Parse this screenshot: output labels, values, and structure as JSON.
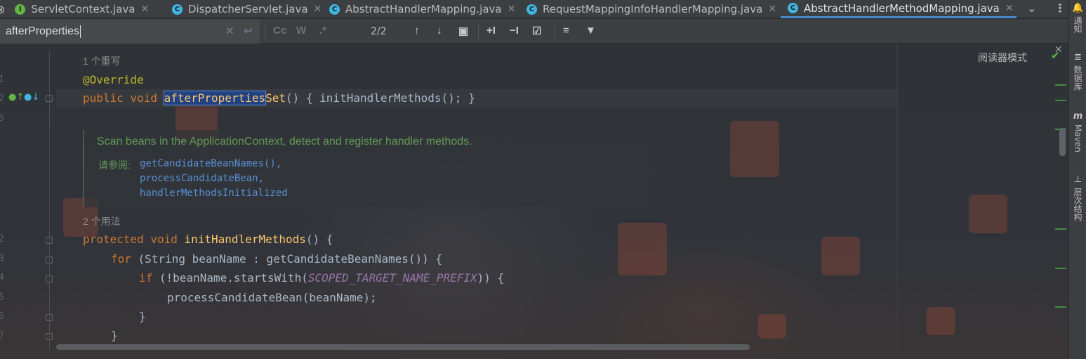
{
  "tabs": [
    {
      "label": "ServletContext.java",
      "icon": "interface-icon",
      "badge": "I",
      "active": false
    },
    {
      "label": "DispatcherServlet.java",
      "icon": "class-icon",
      "badge": "C",
      "active": false
    },
    {
      "label": "AbstractHandlerMapping.java",
      "icon": "class-icon",
      "badge": "C",
      "active": false
    },
    {
      "label": "RequestMappingInfoHandlerMapping.java",
      "icon": "class-icon",
      "badge": "C",
      "active": false
    },
    {
      "label": "AbstractHandlerMethodMapping.java",
      "icon": "class-icon",
      "badge": "C",
      "active": true
    }
  ],
  "search": {
    "value": "afterProperties",
    "match_count": "2/2",
    "case_btn": "Cc",
    "words_btn": "W",
    "regex_btn": ".*"
  },
  "editor": {
    "reader_mode": "阅读器模式",
    "hint_overrides": "1 个重写",
    "annotation": "@Override",
    "line_after_props": {
      "kw": "public void ",
      "match": "afterProperties",
      "rest_fn": "Set",
      "rest": "() { initHandlerMethods(); }"
    },
    "doc": {
      "text": "Scan beans in the ApplicationContext, detect and register handler methods.",
      "see_label": "请参阅:",
      "links": [
        "getCandidateBeanNames(),",
        "processCandidateBean,",
        "handlerMethodsInitialized"
      ]
    },
    "hint_usages": "2 个用法",
    "lines": {
      "l1_kw": "protected void ",
      "l1_fn": "initHandlerMethods",
      "l1_rest": "() {",
      "l2_kw": "for ",
      "l2_rest": "(String beanName : getCandidateBeanNames()) {",
      "l3_kw": "if ",
      "l3_a": "(!beanName.startsWith(",
      "l3_const": "SCOPED_TARGET_NAME_PREFIX",
      "l3_b": ")) {",
      "l4": "processCandidateBean(beanName);",
      "l5": "}",
      "l6": "}"
    },
    "line_numbers": [
      "1",
      "2",
      "5",
      "2",
      "3",
      "4",
      "5",
      "6",
      "7"
    ]
  },
  "right_tools": {
    "notifications": "通知",
    "database": "数据库",
    "maven": "Maven",
    "structure": "层次结构"
  },
  "colors": {
    "keyword": "#cc7832",
    "function": "#ffc66d",
    "annotation": "#bbb529",
    "doc": "#629755",
    "link": "#5a8fd6",
    "constant": "#9876aa",
    "accent": "#4a88c7"
  }
}
